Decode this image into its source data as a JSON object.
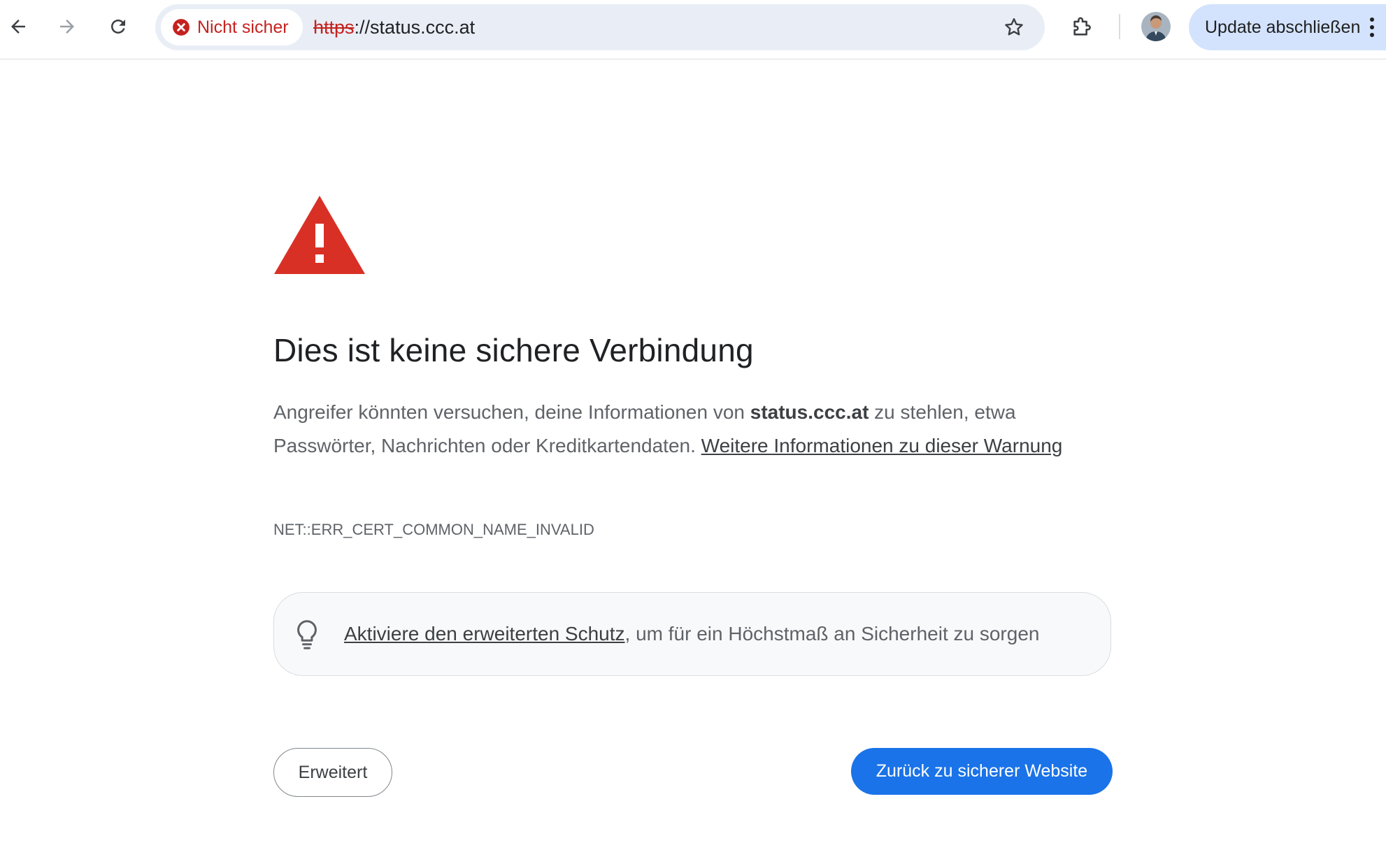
{
  "browser": {
    "security_chip_label": "Nicht sicher",
    "url_scheme": "https",
    "url_rest": "://status.ccc.at",
    "update_button_label": "Update abschließen",
    "icons": {
      "back": "arrow-left-icon",
      "forward": "arrow-right-icon",
      "reload": "reload-icon",
      "security": "error-circle-icon",
      "bookmark": "star-icon",
      "extensions": "puzzle-icon",
      "profile": "avatar",
      "menu": "kebab-menu-icon"
    },
    "colors": {
      "not_secure": "#c5221f",
      "omnibox_bg": "#e9eef6",
      "update_bg": "#d3e3fd"
    }
  },
  "interstitial": {
    "heading": "Dies ist keine sichere Verbindung",
    "explanation_part1": "Angreifer könnten versuchen, deine Informationen von ",
    "host": "status.ccc.at",
    "explanation_part2": " zu stehlen, etwa Passwörter, Nachrichten oder Kreditkartendaten. ",
    "learn_more_link": "Weitere Informationen zu dieser Warnung",
    "error_code": "NET::ERR_CERT_COMMON_NAME_INVALID",
    "enhanced_protection_link": "Aktiviere den erweiterten Schutz",
    "enhanced_protection_text": ", um für ein Höchstmaß an Sicherheit zu sorgen",
    "advanced_button_label": "Erweitert",
    "back_button_label": "Zurück zu sicherer Website",
    "colors": {
      "warning_red": "#d93025",
      "primary_blue": "#1a73e8"
    }
  }
}
